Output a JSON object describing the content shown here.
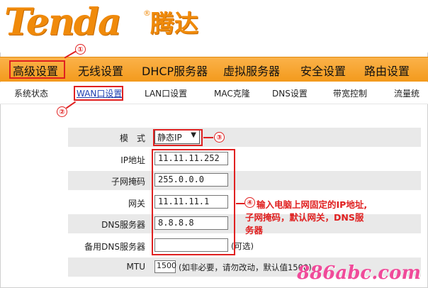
{
  "brand": {
    "logo": "Tenda",
    "cn_name": "腾达",
    "reg": "®"
  },
  "menu": [
    {
      "label": "高级设置"
    },
    {
      "label": "无线设置"
    },
    {
      "label": "DHCP服务器"
    },
    {
      "label": "虚拟服务器"
    },
    {
      "label": "安全设置"
    },
    {
      "label": "路由设置"
    }
  ],
  "submenu": [
    {
      "label": "系统状态"
    },
    {
      "label": "WAN口设置"
    },
    {
      "label": "LAN口设置"
    },
    {
      "label": "MAC克隆"
    },
    {
      "label": "DNS设置"
    },
    {
      "label": "带宽控制"
    },
    {
      "label": "流量统"
    }
  ],
  "form": {
    "mode_label": "模　式",
    "mode_value": "静态IP",
    "ip_label": "IP地址",
    "ip_value": "11.11.11.252",
    "mask_label": "子网掩码",
    "mask_value": "255.0.0.0",
    "gateway_label": "网关",
    "gateway_value": "11.11.11.1",
    "dns_label": "DNS服务器",
    "dns_value": "8.8.8.8",
    "dns2_label": "备用DNS服务器",
    "dns2_value": "",
    "dns2_note": "(可选)",
    "mtu_label": "MTU",
    "mtu_value": "1500",
    "mtu_note": "(如非必要，请勿改动，默认值1500)"
  },
  "annotations": {
    "n1": "①",
    "n2": "②",
    "n3": "③",
    "n4": "④",
    "note4_line1": "输入电脑上网固定的IP地址,",
    "note4_line2": "子网掩码，默认网关，DNS服",
    "note4_line3": "务器"
  },
  "watermark": "886abc.com",
  "colors": {
    "accent": "#f39a1c",
    "annotation": "#e02020",
    "watermark": "#f04b9a"
  }
}
